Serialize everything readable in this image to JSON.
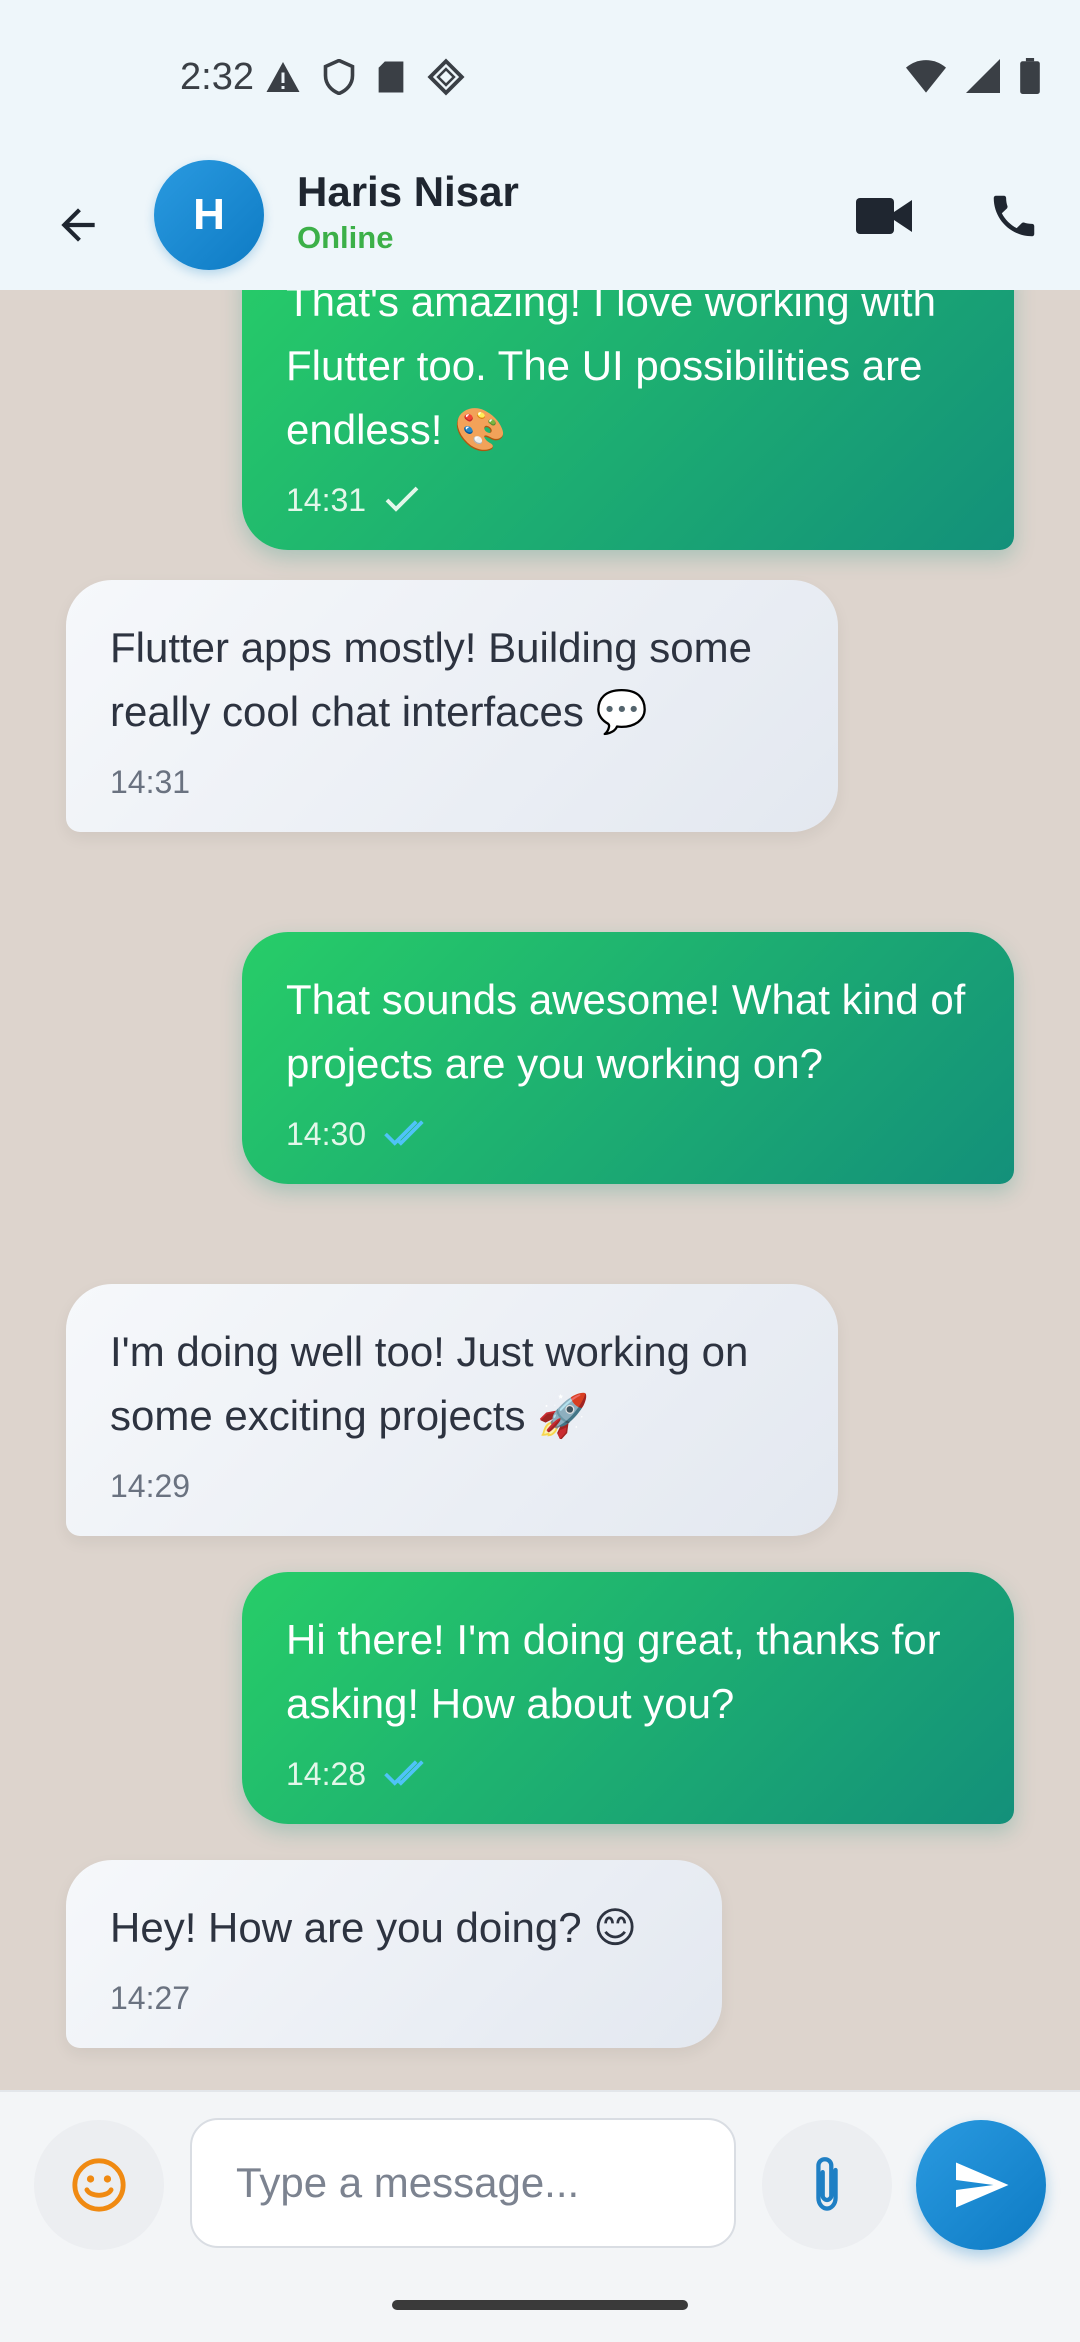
{
  "status_bar": {
    "time": "2:32",
    "left_icons": [
      "warning-icon",
      "shield-icon",
      "sd-card-icon",
      "vpn-icon"
    ],
    "right_icons": [
      "wifi-icon",
      "cell-signal-icon",
      "battery-icon"
    ]
  },
  "header": {
    "avatar_initial": "H",
    "contact_name": "Haris Nisar",
    "contact_status": "Online",
    "status_color": "#3cb048"
  },
  "messages": [
    {
      "direction": "out",
      "text": "That's amazing! I love working with Flutter too. The UI possibilities are endless! 🎨",
      "time": "14:31",
      "receipt": "sent"
    },
    {
      "direction": "in",
      "text": "Flutter apps mostly! Building some really cool chat interfaces 💬",
      "time": "14:31"
    },
    {
      "direction": "out",
      "text": "That sounds awesome! What kind of projects are you working on?",
      "time": "14:30",
      "receipt": "read"
    },
    {
      "direction": "in",
      "text": "I'm doing well too! Just working on some exciting projects 🚀",
      "time": "14:29"
    },
    {
      "direction": "out",
      "text": "Hi there! I'm doing great, thanks for asking! How about you?",
      "time": "14:28",
      "receipt": "read"
    },
    {
      "direction": "in",
      "text": "Hey! How are you doing? 😊",
      "time": "14:27"
    }
  ],
  "input": {
    "placeholder": "Type a message...",
    "value": ""
  },
  "colors": {
    "accent_blue": "#0e7bc4",
    "outgoing_gradient_start": "#27cd68",
    "outgoing_gradient_end": "#13907a",
    "read_receipt": "#4fc3f7",
    "chat_background": "#ddd4cd"
  }
}
